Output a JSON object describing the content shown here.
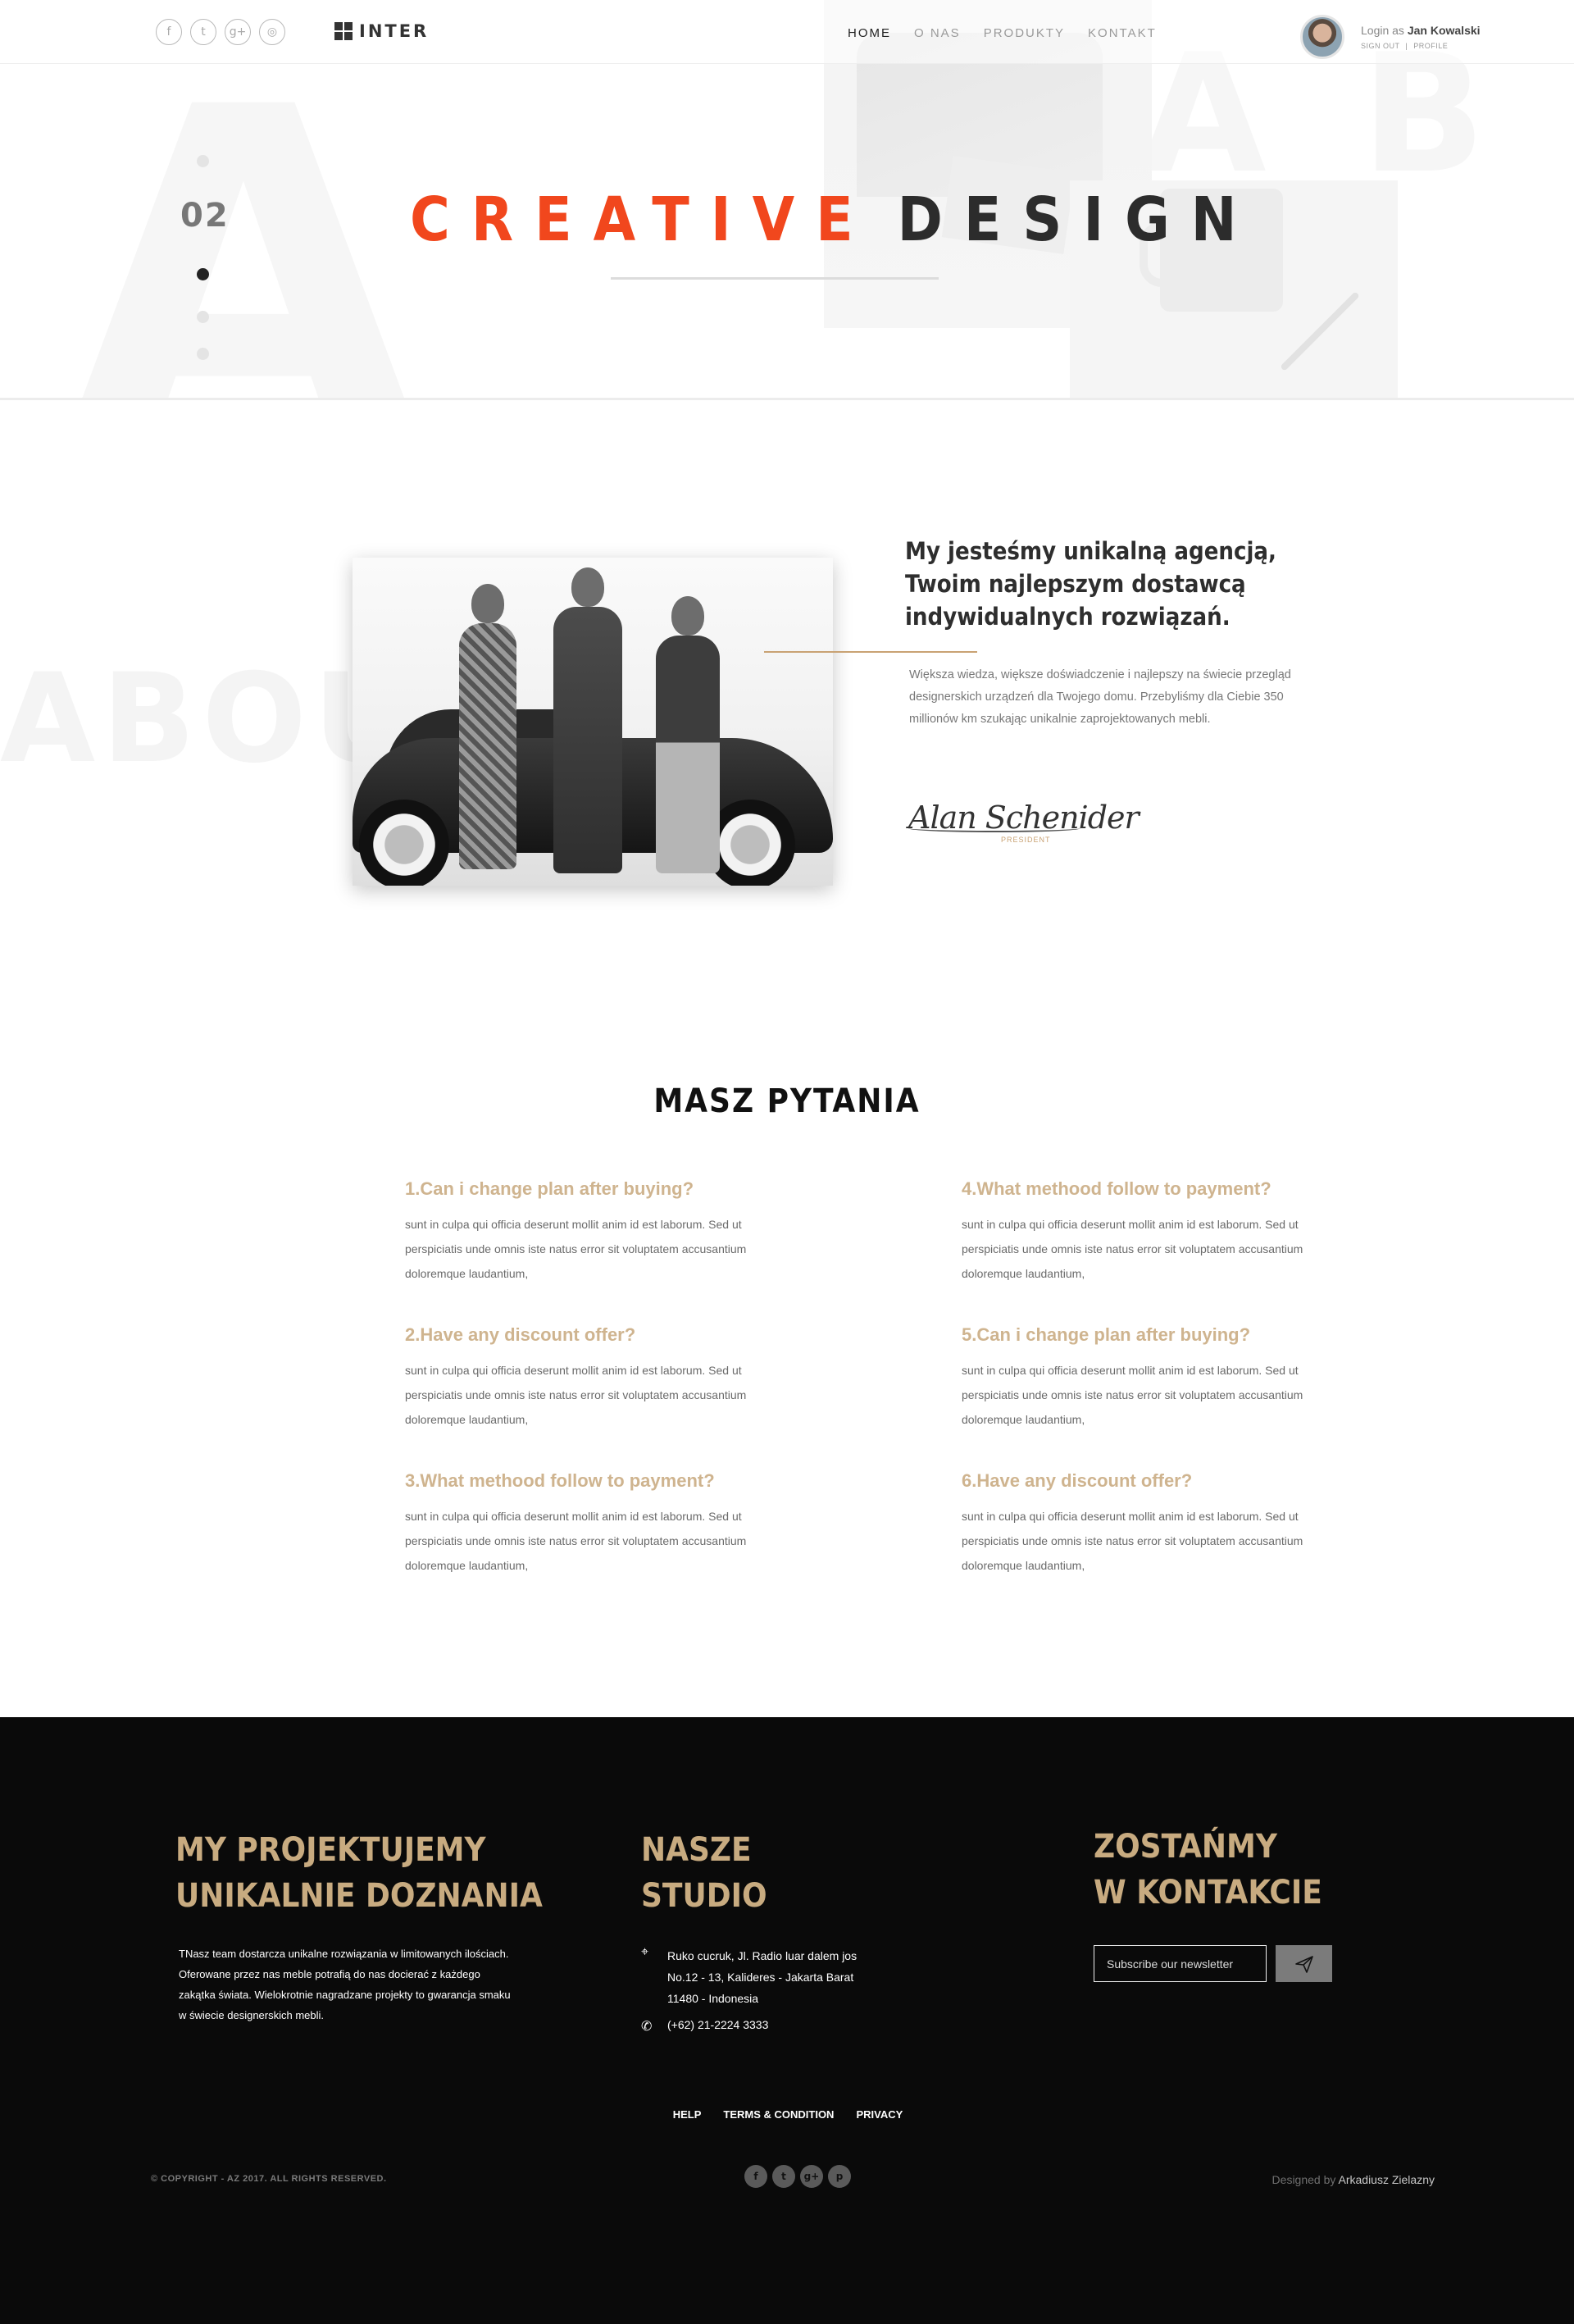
{
  "header": {
    "social_icons": [
      {
        "name": "facebook-icon",
        "glyph": "f"
      },
      {
        "name": "twitter-icon",
        "glyph": "t"
      },
      {
        "name": "google-plus-icon",
        "glyph": "g+"
      },
      {
        "name": "instagram-icon",
        "glyph": "◎"
      }
    ],
    "logo": "INTER",
    "nav": [
      "HOME",
      "O NAS",
      "PRODUKTY",
      "KONTAKT"
    ],
    "user": {
      "login_prefix": "Login as",
      "name": "Jan Kowalski",
      "sign_out": "SIGN OUT",
      "separator": "|",
      "profile": "PROFILE"
    }
  },
  "hero": {
    "slide_number": "02",
    "title_accent": "CREATIVE",
    "title_rest": "DESIGN",
    "bg_letters": [
      "A",
      "A",
      "B"
    ],
    "accent_color": "#f1471d"
  },
  "about": {
    "bg_word": "ABOUT",
    "heading": "My jesteśmy unikalną agencją, Twoim najlepszym dostawcą indywidualnych rozwiązań.",
    "text": "Większa wiedza, większe doświadczenie i najlepszy na świecie przegląd designerskich urządzeń dla Twojego domu. Przebyliśmy dla Ciebie  350 millionów km szukając unikalnie zaprojektowanych mebli.",
    "signature_name": "Alan Schenider",
    "signature_role": "PRESIDENT",
    "line_color": "#c9a273"
  },
  "faq": {
    "title": "MASZ PYTANIA",
    "items": [
      {
        "q": "1.Can i change plan after buying?",
        "a": "sunt in culpa qui officia deserunt mollit anim id est laborum. Sed ut perspiciatis unde omnis iste natus error sit voluptatem accusantium doloremque laudantium,"
      },
      {
        "q": "2.Have any discount offer?",
        "a": "sunt in culpa qui officia deserunt mollit anim id est laborum. Sed ut perspiciatis unde omnis iste natus error sit voluptatem accusantium doloremque laudantium,"
      },
      {
        "q": "3.What methood follow to payment?",
        "a": "sunt in culpa qui officia deserunt mollit anim id est laborum. Sed ut perspiciatis unde omnis iste natus error sit voluptatem accusantium doloremque laudantium,"
      },
      {
        "q": "4.What methood follow to payment?",
        "a": "sunt in culpa qui officia deserunt mollit anim id est laborum. Sed ut perspiciatis unde omnis iste natus error sit voluptatem accusantium doloremque laudantium,"
      },
      {
        "q": "5.Can i change plan after buying?",
        "a": "sunt in culpa qui officia deserunt mollit anim id est laborum. Sed ut perspiciatis unde omnis iste natus error sit voluptatem accusantium doloremque laudantium,"
      },
      {
        "q": "6.Have any discount offer?",
        "a": "sunt in culpa qui officia deserunt mollit anim id est laborum. Sed ut perspiciatis unde omnis iste natus error sit voluptatem accusantium doloremque laudantium,"
      }
    ],
    "question_color": "#cfb48f"
  },
  "footer": {
    "col1_heading_line1": "MY PROJEKTUJEMY",
    "col1_heading_line2": "UNIKALNIE DOZNANIA",
    "col1_text": "TNasz team dostarcza unikalne rozwiązania w limitowanych ilościach. Oferowane przez nas meble potrafią do nas docierać z każdego zakątka świata. Wielokrotnie nagradzane projekty to gwarancja smaku w świecie  designerskich mebli.",
    "col2_heading_line1": "NASZE",
    "col2_heading_line2": "STUDIO",
    "address": "Ruko cucruk, Jl. Radio luar dalem jos No.12 - 13, Kalideres - Jakarta Barat 11480 - Indonesia",
    "phone": "(+62) 21-2224 3333",
    "col3_heading_line1": "ZOSTAŃMY",
    "col3_heading_line2": "W KONTAKCIE",
    "newsletter_placeholder": "Subscribe our newsletter",
    "links": [
      "HELP",
      "TERMS & CONDITION",
      "PRIVACY"
    ],
    "copyright": "© COPYRIGHT - AZ 2017. ALL RIGHTS RESERVED.",
    "social_icons": [
      {
        "name": "facebook-icon",
        "glyph": "f"
      },
      {
        "name": "twitter-icon",
        "glyph": "t"
      },
      {
        "name": "google-plus-icon",
        "glyph": "g+"
      },
      {
        "name": "pinterest-icon",
        "glyph": "p"
      }
    ],
    "designed_prefix": "Designed by",
    "designed_name": "Arkadiusz Zielazny",
    "heading_color": "#c8ab80"
  }
}
